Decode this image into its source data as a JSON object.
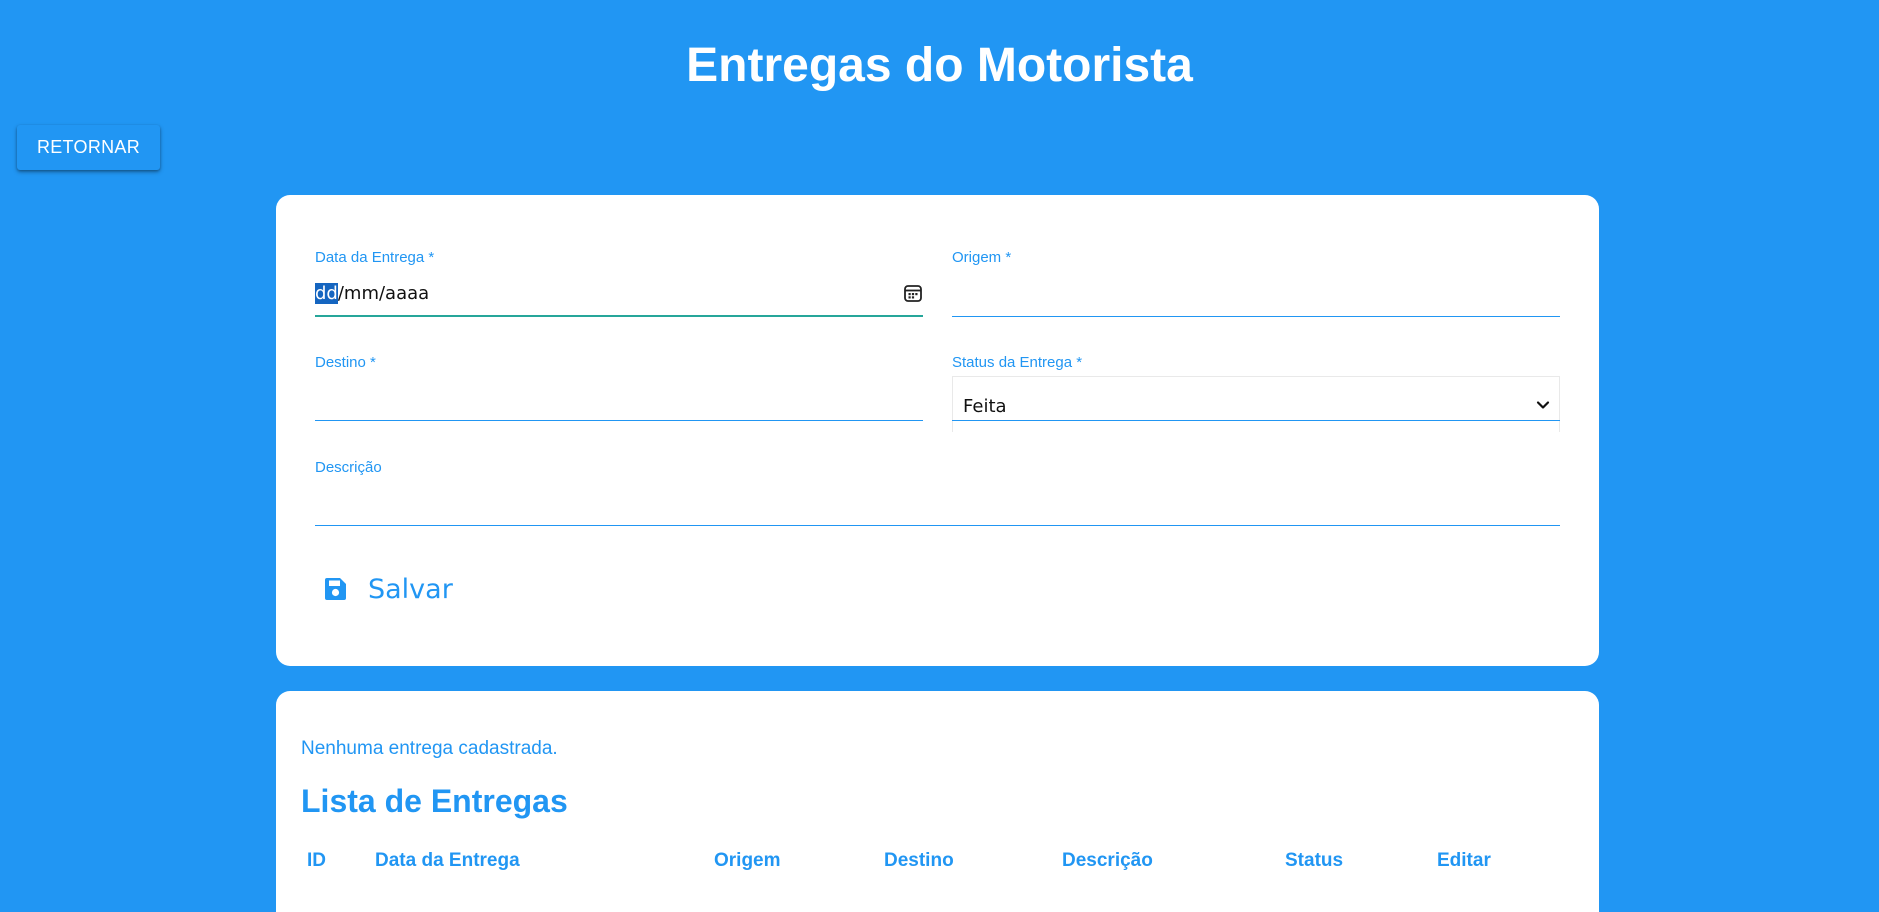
{
  "header": {
    "title": "Entregas do Motorista",
    "back_label": "RETORNAR"
  },
  "form": {
    "date": {
      "label": "Data da Entrega *",
      "value_day": "dd",
      "value_rest": "/mm/aaaa",
      "icon": "calendar-icon"
    },
    "origin": {
      "label": "Origem *",
      "value": ""
    },
    "destination": {
      "label": "Destino *",
      "value": ""
    },
    "status": {
      "label": "Status da Entrega *",
      "selected": "Feita",
      "icon": "chevron-down-icon"
    },
    "description": {
      "label": "Descrição",
      "value": ""
    },
    "save": {
      "label": "Salvar",
      "icon": "floppy-disk-icon"
    }
  },
  "list": {
    "empty_message": "Nenhuma entrega cadastrada.",
    "heading": "Lista de Entregas",
    "columns": [
      "ID",
      "Data da Entrega",
      "Origem",
      "Destino",
      "Descrição",
      "Status",
      "Editar"
    ]
  },
  "colors": {
    "background": "#2196f3",
    "accent": "#2196f3",
    "focus_underline": "#26a69a",
    "card": "#ffffff"
  }
}
